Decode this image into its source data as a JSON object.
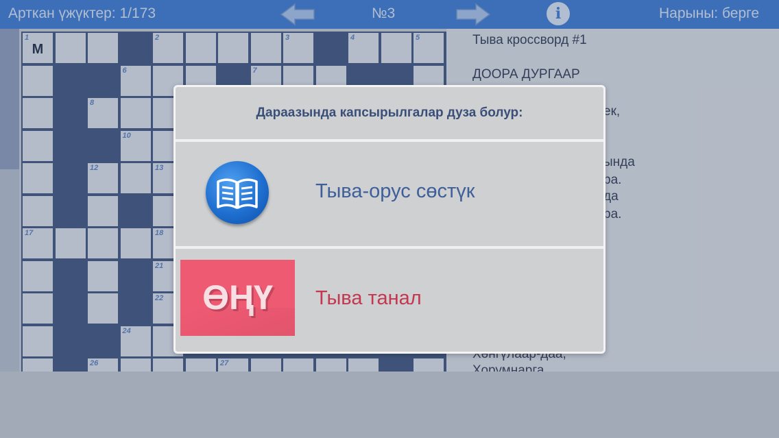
{
  "topbar": {
    "remaining": "Арткан үжүктер: 1/173",
    "puzzle_number": "№3",
    "direction": "Нарыны: берге",
    "icons": {
      "prev": "arrow-left-icon",
      "next": "arrow-right-icon",
      "info": "info-icon"
    },
    "info_symbol": "i"
  },
  "grid": {
    "cells": [
      {
        "r": 0,
        "c": 0,
        "num": "1",
        "letter": "М"
      },
      {
        "r": 0,
        "c": 1
      },
      {
        "r": 0,
        "c": 2
      },
      {
        "r": 0,
        "c": 4,
        "num": "2"
      },
      {
        "r": 0,
        "c": 5
      },
      {
        "r": 0,
        "c": 6
      },
      {
        "r": 0,
        "c": 7
      },
      {
        "r": 0,
        "c": 8,
        "num": "3"
      },
      {
        "r": 0,
        "c": 10,
        "num": "4"
      },
      {
        "r": 0,
        "c": 11
      },
      {
        "r": 0,
        "c": 12,
        "num": "5"
      },
      {
        "r": 1,
        "c": 0
      },
      {
        "r": 1,
        "c": 3,
        "num": "6"
      },
      {
        "r": 1,
        "c": 4
      },
      {
        "r": 1,
        "c": 5
      },
      {
        "r": 1,
        "c": 7,
        "num": "7"
      },
      {
        "r": 1,
        "c": 8
      },
      {
        "r": 1,
        "c": 9
      },
      {
        "r": 1,
        "c": 12
      },
      {
        "r": 2,
        "c": 0
      },
      {
        "r": 2,
        "c": 2,
        "num": "8"
      },
      {
        "r": 2,
        "c": 3
      },
      {
        "r": 2,
        "c": 4
      },
      {
        "r": 3,
        "c": 0
      },
      {
        "r": 3,
        "c": 3,
        "num": "10"
      },
      {
        "r": 3,
        "c": 4
      },
      {
        "r": 4,
        "c": 0
      },
      {
        "r": 4,
        "c": 2,
        "num": "12"
      },
      {
        "r": 4,
        "c": 3
      },
      {
        "r": 4,
        "c": 4,
        "num": "13"
      },
      {
        "r": 5,
        "c": 0
      },
      {
        "r": 5,
        "c": 2
      },
      {
        "r": 5,
        "c": 4
      },
      {
        "r": 6,
        "c": 0,
        "num": "17"
      },
      {
        "r": 6,
        "c": 1
      },
      {
        "r": 6,
        "c": 2
      },
      {
        "r": 6,
        "c": 3
      },
      {
        "r": 6,
        "c": 4,
        "num": "18"
      },
      {
        "r": 7,
        "c": 0
      },
      {
        "r": 7,
        "c": 2
      },
      {
        "r": 7,
        "c": 4,
        "num": "21"
      },
      {
        "r": 8,
        "c": 0
      },
      {
        "r": 8,
        "c": 2
      },
      {
        "r": 8,
        "c": 4,
        "num": "22"
      },
      {
        "r": 9,
        "c": 0
      },
      {
        "r": 9,
        "c": 3,
        "num": "24"
      },
      {
        "r": 9,
        "c": 4
      },
      {
        "r": 10,
        "c": 0
      },
      {
        "r": 10,
        "c": 2,
        "num": "26"
      },
      {
        "r": 10,
        "c": 3
      },
      {
        "r": 10,
        "c": 4
      },
      {
        "r": 10,
        "c": 5
      },
      {
        "r": 10,
        "c": 6,
        "num": "27"
      },
      {
        "r": 10,
        "c": 7
      },
      {
        "r": 10,
        "c": 8
      },
      {
        "r": 10,
        "c": 9
      },
      {
        "r": 10,
        "c": 10
      },
      {
        "r": 10,
        "c": 12
      }
    ]
  },
  "rightpanel": {
    "title": "Тыва кроссворд #1",
    "section": "ДООРА ДУРГААР",
    "fragments": [
      "ек,",
      "ындa",
      "ра.",
      "да",
      "ра."
    ],
    "bottom_lines": [
      "Хөнгүлаар-даа,",
      "Хорумнарга"
    ]
  },
  "dialog": {
    "title": "Дараазында капсырылгалар дуза болур:",
    "options": [
      {
        "label": "Тыва-орус сөстүк",
        "icon": "book-icon",
        "color": "#3e5f9a"
      },
      {
        "label": "Тыва танал",
        "logo_text": "ӨҢҮ",
        "color": "#c4374f"
      }
    ]
  }
}
